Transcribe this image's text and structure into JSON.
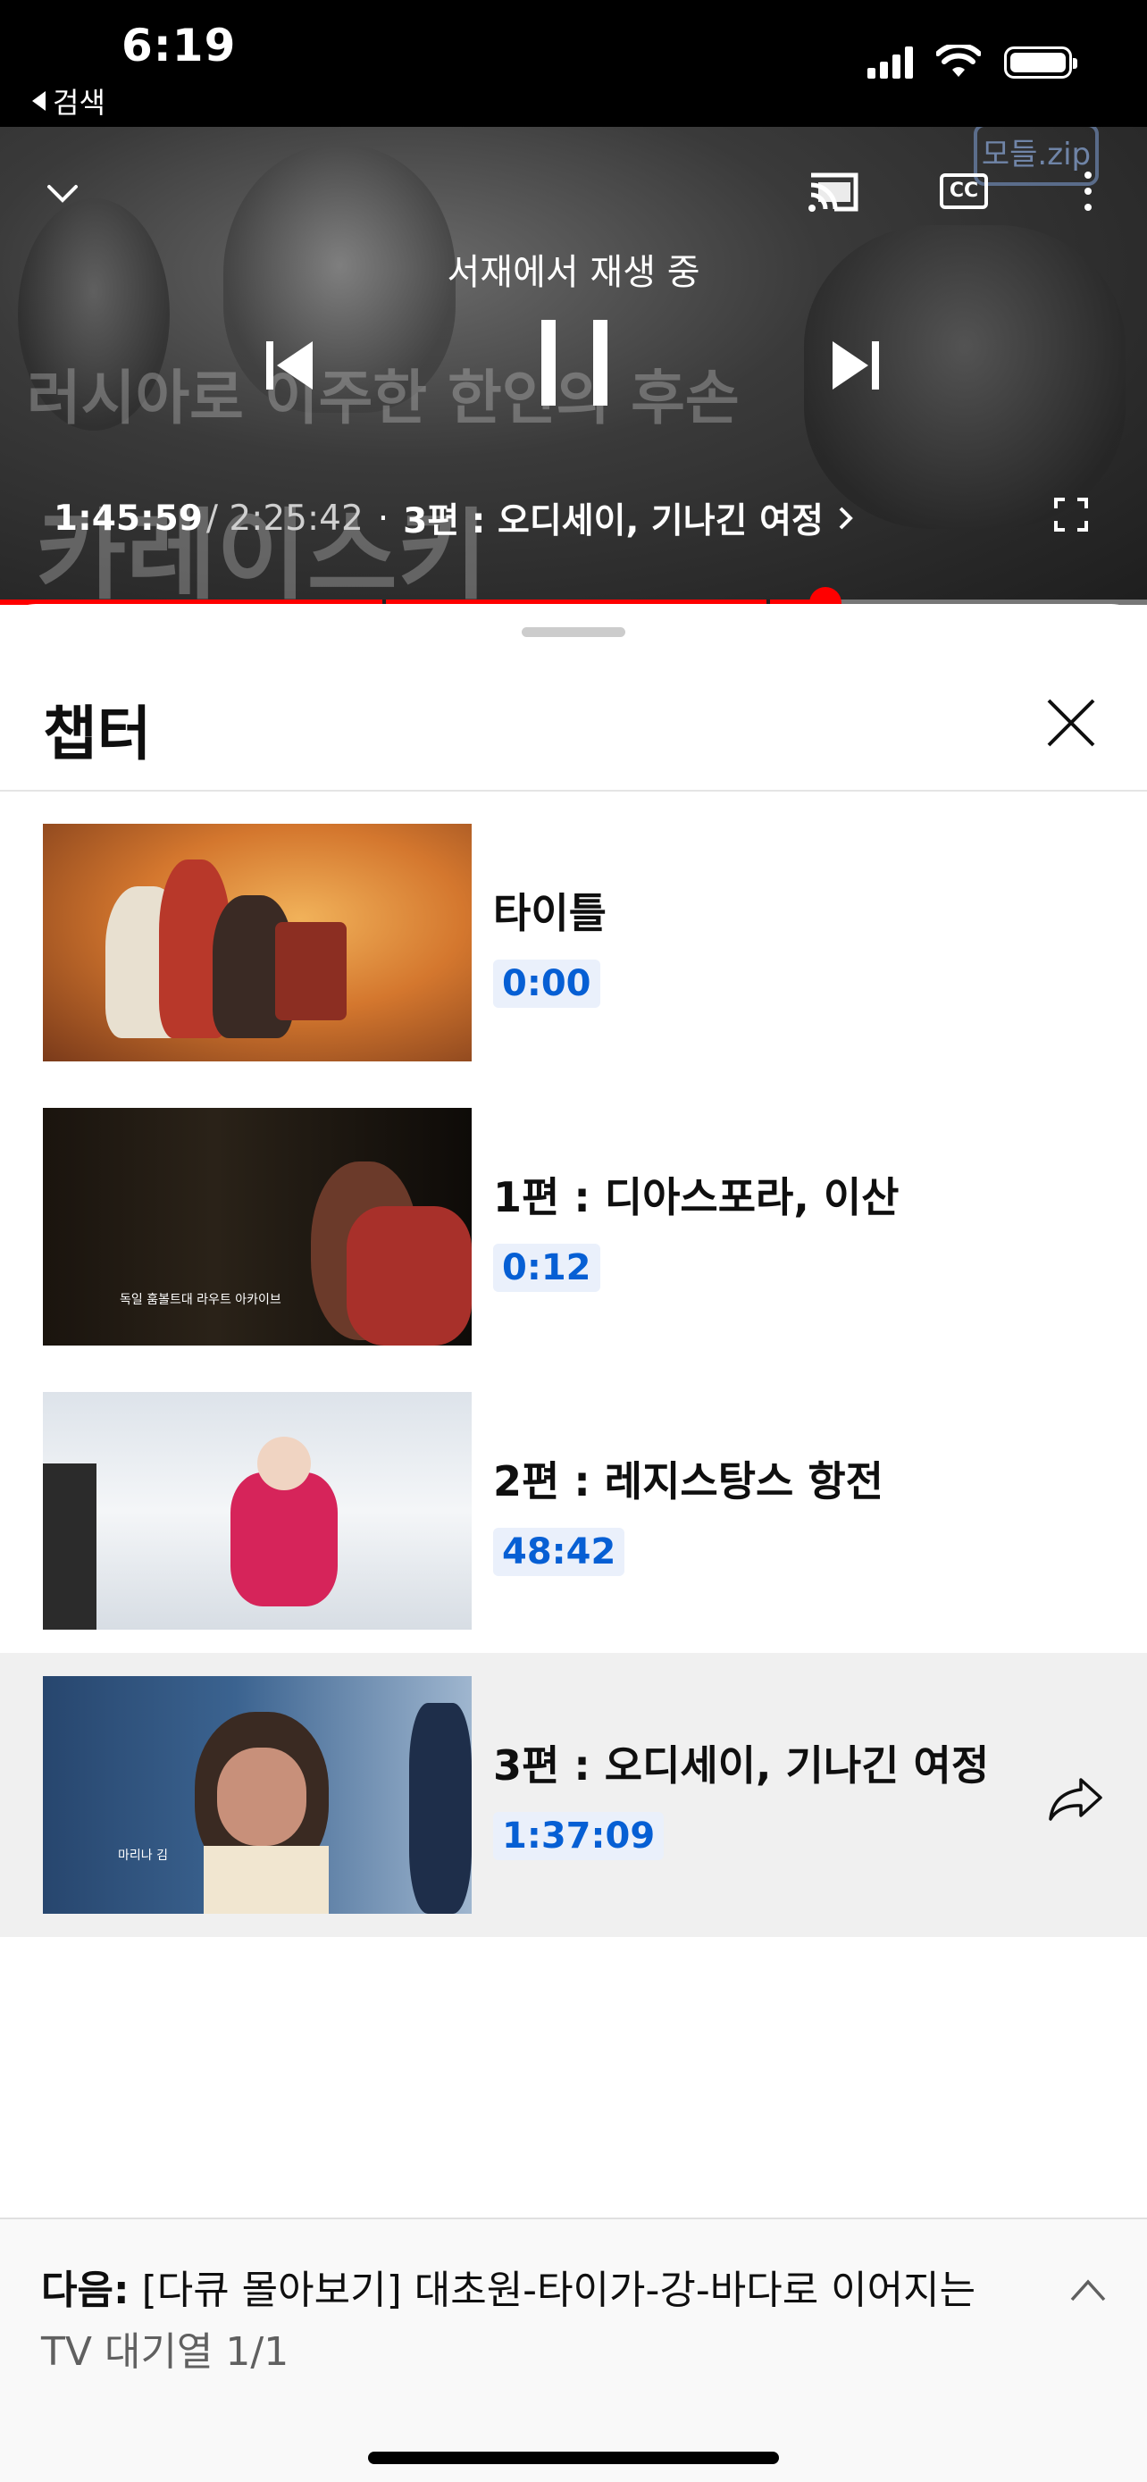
{
  "status_bar": {
    "time": "6:19",
    "back_label": "검색"
  },
  "player": {
    "playing_on": "서재에서 재생 중",
    "current_time": "1:45:59",
    "total_time": "/ 2:25:42",
    "separator": "·",
    "chapter": "3편 : 오디세이, 기나긴 여정",
    "cc_label": "CC",
    "progress_fraction": 0.72,
    "scene_text_line1": "러시아로 이주한 한인의 후손",
    "scene_text_line2": "카레이스키",
    "scene_logo": "모들.zip"
  },
  "sheet": {
    "title": "챕터",
    "chapters": [
      {
        "title": "타이틀",
        "time": "0:00",
        "active": false
      },
      {
        "title": "1편 : 디아스포라, 이산",
        "time": "0:12",
        "active": false,
        "thumb_caption": "독일 훔볼트대 라우트 아카이브"
      },
      {
        "title": "2편 : 레지스탕스 항전",
        "time": "48:42",
        "active": false
      },
      {
        "title": "3편 : 오디세이, 기나긴 여정",
        "time": "1:37:09",
        "active": true,
        "thumb_caption": "마리나 김"
      }
    ]
  },
  "footer": {
    "up_next_label": "다음:",
    "up_next_title": "[다큐 몰아보기] 대초원-타이가-강-바다로 이어지는",
    "queue": "TV 대기열 1/1"
  },
  "colors": {
    "accent_red": "#ff0000",
    "timestamp_blue": "#065fd4",
    "active_row_bg": "#f0f0f0"
  }
}
